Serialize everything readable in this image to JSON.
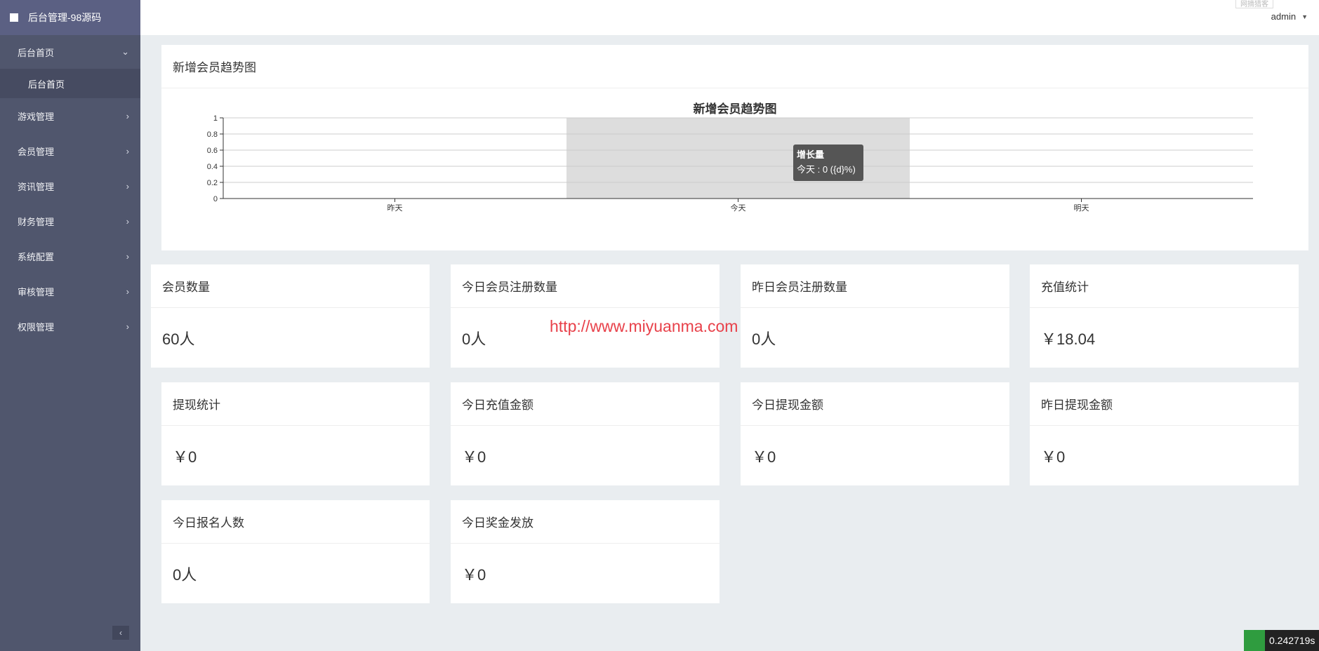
{
  "app": {
    "title": "后台管理-98源码"
  },
  "sidebar": {
    "items": [
      {
        "label": "后台首页",
        "open": true,
        "children": [
          {
            "label": "后台首页"
          }
        ]
      },
      {
        "label": "游戏管理"
      },
      {
        "label": "会员管理"
      },
      {
        "label": "资讯管理"
      },
      {
        "label": "财务管理"
      },
      {
        "label": "系统配置"
      },
      {
        "label": "审核管理"
      },
      {
        "label": "权限管理"
      }
    ],
    "collapse_glyph": "‹"
  },
  "header": {
    "user": "admin",
    "top_badge": "网摘猎客"
  },
  "chart_card": {
    "header": "新增会员趋势图"
  },
  "chart_data": {
    "type": "line",
    "title": "新增会员趋势图",
    "categories": [
      "昨天",
      "今天",
      "明天"
    ],
    "series": [
      {
        "name": "增长量",
        "values": [
          0,
          0,
          0
        ]
      }
    ],
    "ylim": [
      0,
      1
    ],
    "yticks": [
      "0",
      "0.2",
      "0.4",
      "0.6",
      "0.8",
      "1"
    ],
    "highlighted_category": "今天",
    "tooltip": {
      "title": "增长量",
      "line": "今天 : 0 ({d}%)"
    },
    "grid": true
  },
  "stats": [
    {
      "title": "会员数量",
      "value": "60人"
    },
    {
      "title": "今日会员注册数量",
      "value": "0人"
    },
    {
      "title": "昨日会员注册数量",
      "value": "0人"
    },
    {
      "title": "充值统计",
      "value": "￥18.04"
    },
    {
      "title": "提现统计",
      "value": "￥0"
    },
    {
      "title": "今日充值金额",
      "value": "￥0"
    },
    {
      "title": "今日提现金额",
      "value": "￥0"
    },
    {
      "title": "昨日提现金额",
      "value": "￥0"
    },
    {
      "title": "今日报名人数",
      "value": "0人"
    },
    {
      "title": "今日奖金发放",
      "value": "￥0"
    }
  ],
  "watermark_link": "http://www.miyuanma.com",
  "timer": "0.242719s",
  "colors": {
    "sidebar": "#50566d",
    "brand": "#5b6083",
    "highlight": "#dddddd",
    "tooltip": "#555555",
    "watermark": "#e8414a"
  }
}
